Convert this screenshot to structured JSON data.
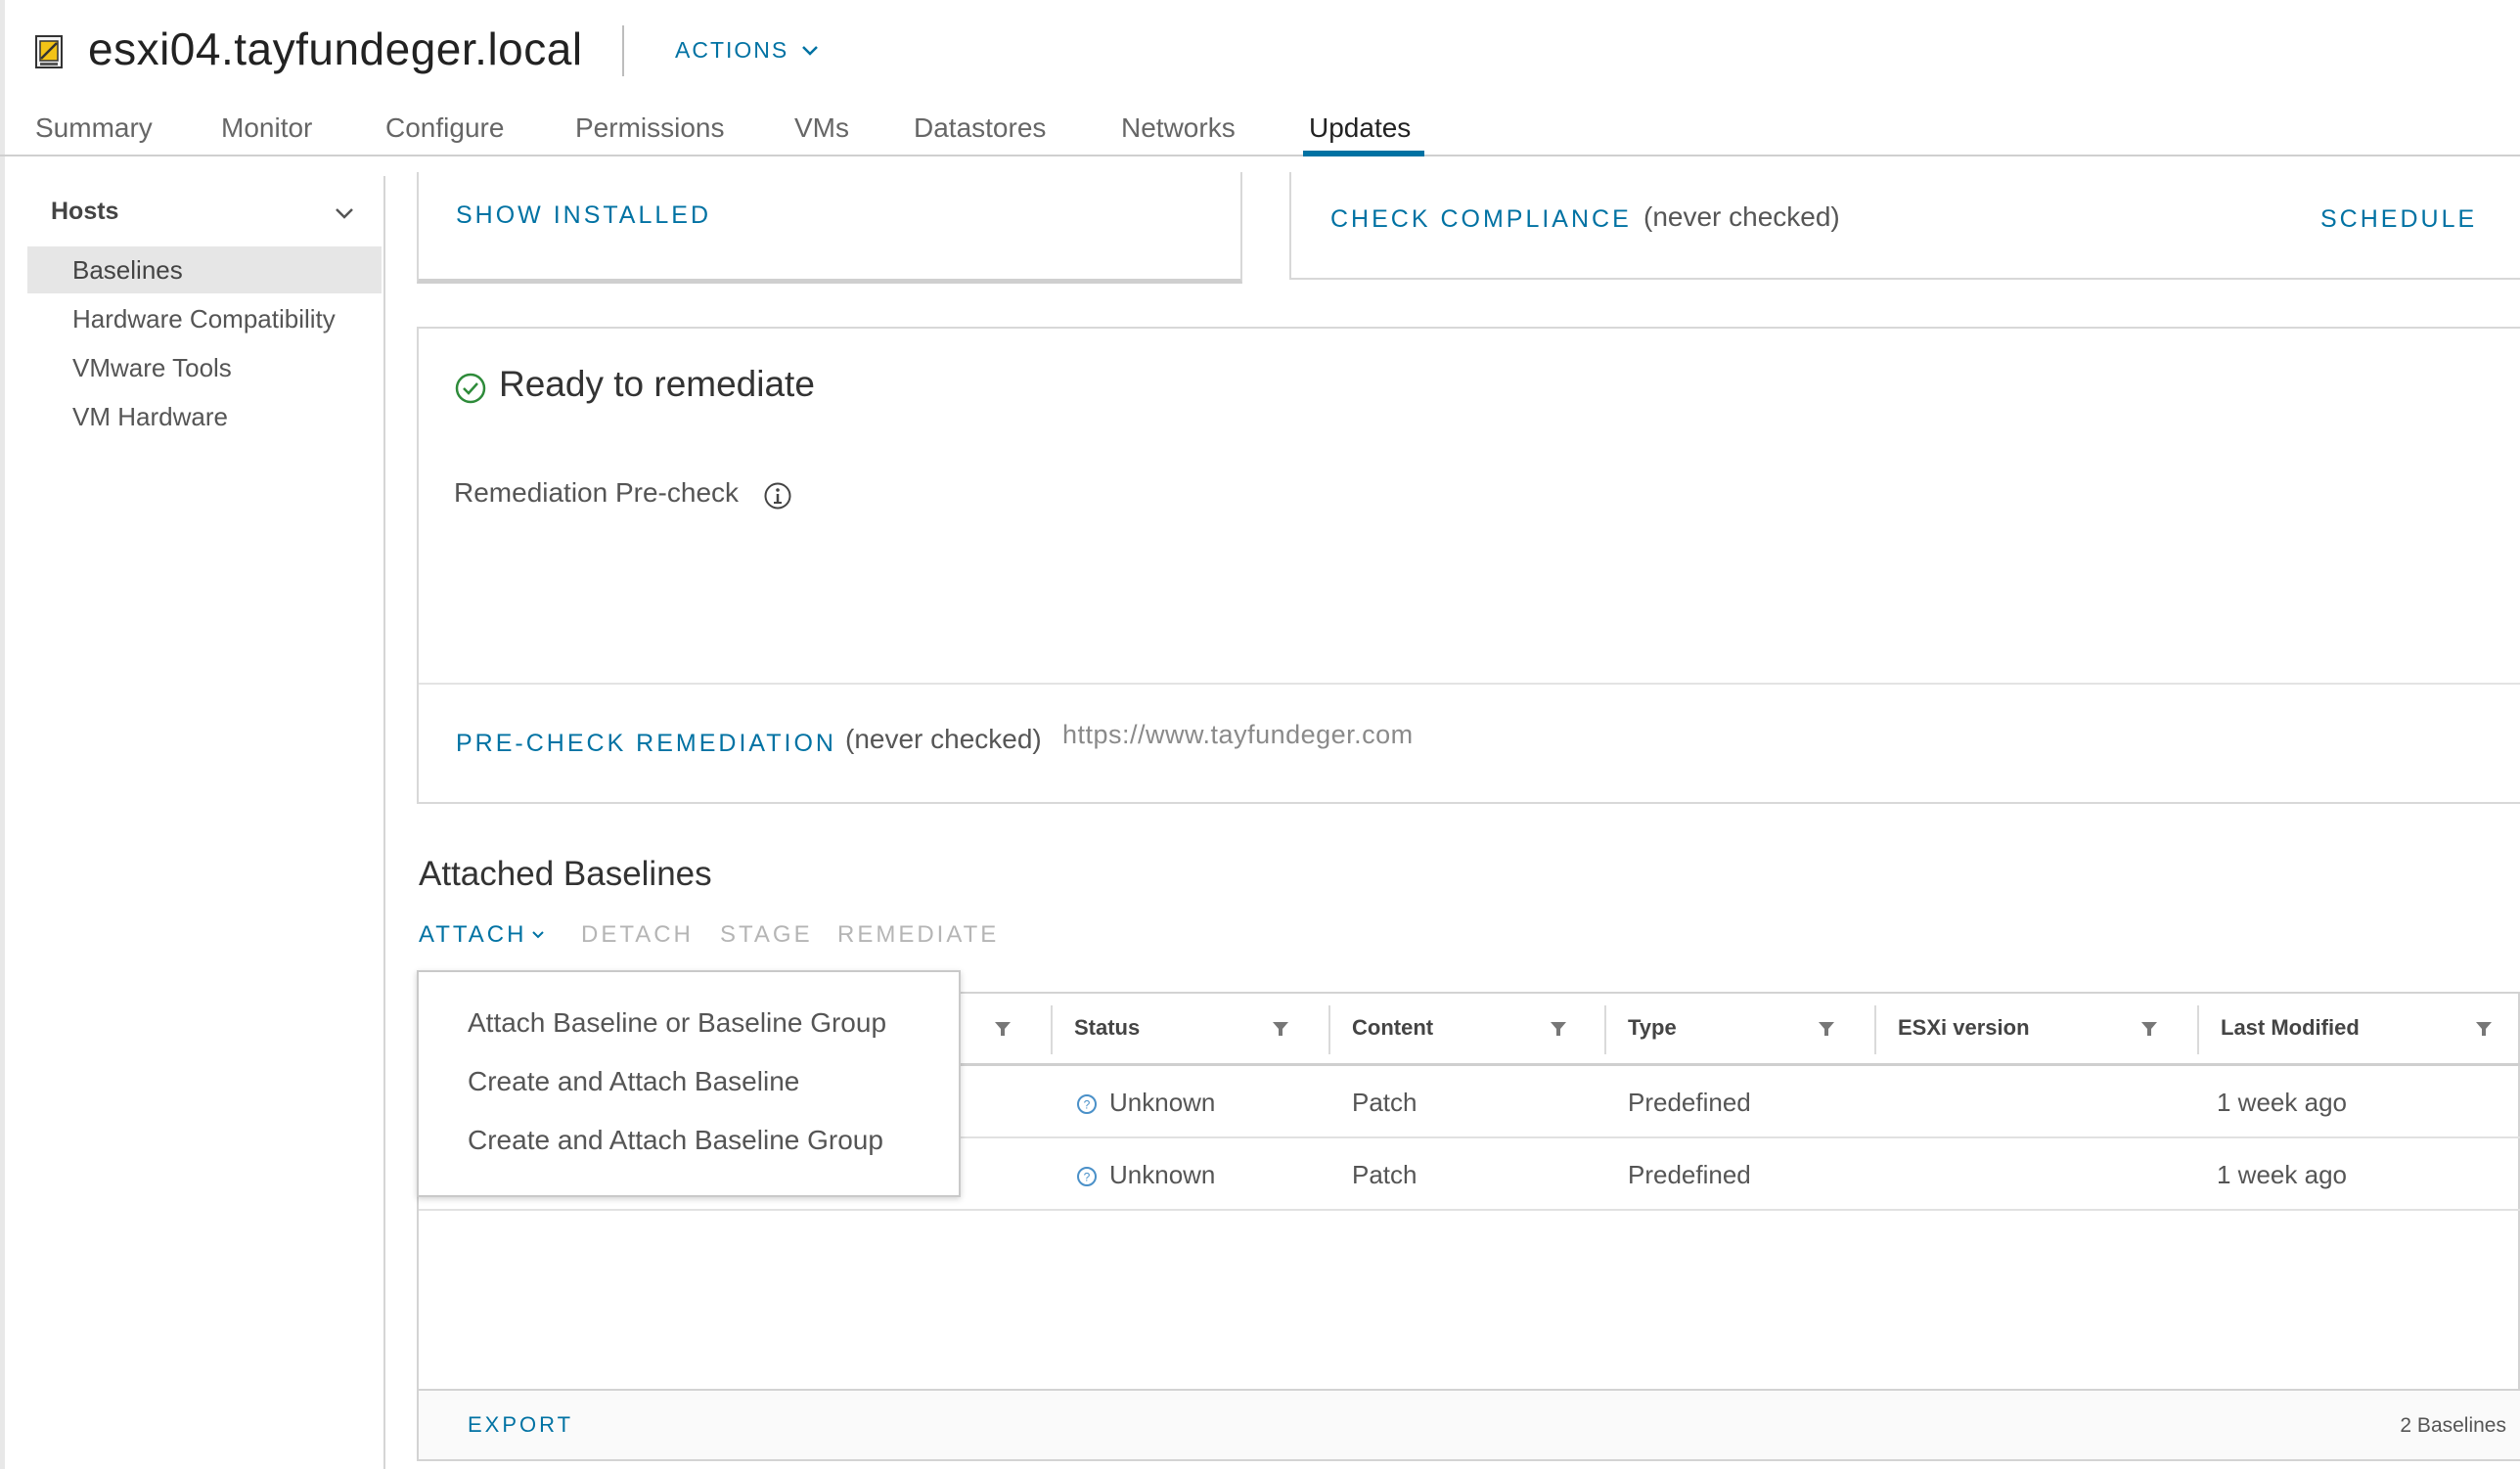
{
  "header": {
    "title": "esxi04.tayfundeger.local",
    "actions_label": "ACTIONS"
  },
  "tabs": [
    {
      "label": "Summary"
    },
    {
      "label": "Monitor"
    },
    {
      "label": "Configure"
    },
    {
      "label": "Permissions"
    },
    {
      "label": "VMs"
    },
    {
      "label": "Datastores"
    },
    {
      "label": "Networks"
    },
    {
      "label": "Updates",
      "active": true
    }
  ],
  "sidebar": {
    "heading": "Hosts",
    "items": [
      {
        "label": "Baselines",
        "selected": true
      },
      {
        "label": "Hardware Compatibility"
      },
      {
        "label": "VMware Tools"
      },
      {
        "label": "VM Hardware"
      }
    ]
  },
  "top_cards": {
    "show_installed": "SHOW INSTALLED",
    "check_compliance": "CHECK COMPLIANCE",
    "compliance_status": "(never checked)",
    "schedule": "SCHEDULE"
  },
  "remediation": {
    "status": "Ready to remediate",
    "precheck_label": "Remediation Pre-check",
    "precheck_button": "PRE-CHECK REMEDIATION",
    "precheck_status": "(never checked)",
    "watermark": "https://www.tayfundeger.com"
  },
  "attached": {
    "title": "Attached Baselines",
    "toolbar": {
      "attach": "ATTACH",
      "detach": "DETACH",
      "stage": "STAGE",
      "remediate": "REMEDIATE"
    },
    "dropdown": [
      "Attach Baseline or Baseline Group",
      "Create and Attach Baseline",
      "Create and Attach Baseline Group"
    ],
    "columns": [
      "Status",
      "Content",
      "Type",
      "ESXi version",
      "Last Modified"
    ],
    "rows": [
      {
        "status": "Unknown",
        "content": "Patch",
        "type": "Predefined",
        "esxi_version": "",
        "last_modified": "1 week ago"
      },
      {
        "status": "Unknown",
        "content": "Patch",
        "type": "Predefined",
        "esxi_version": "",
        "last_modified": "1 week ago"
      }
    ],
    "export": "EXPORT",
    "count": "2 Baselines"
  },
  "colors": {
    "link": "#0072a3",
    "success": "#2e8b3a",
    "tab_active": "#0072a3"
  }
}
